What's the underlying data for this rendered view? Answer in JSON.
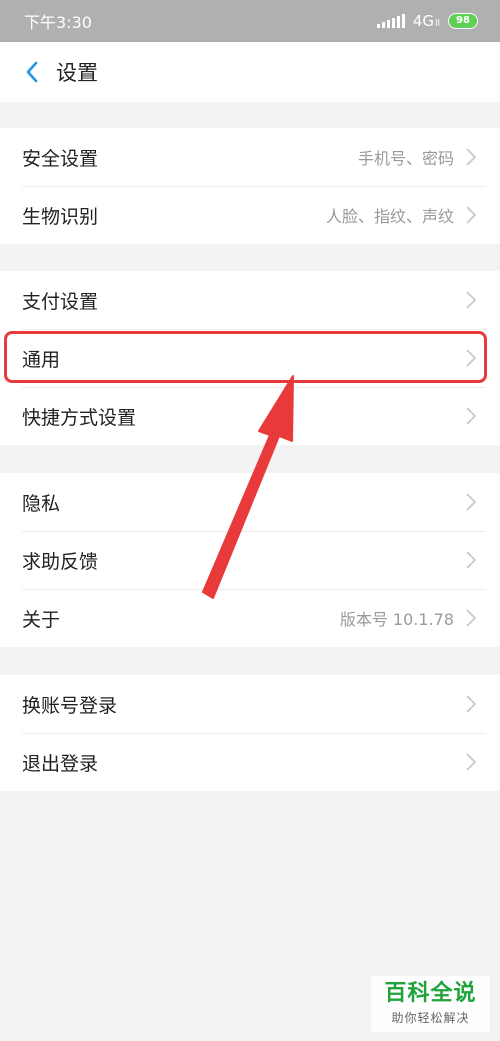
{
  "status_bar": {
    "time": "下午3:30",
    "network": "4G",
    "network_sub": "ll",
    "battery": "98"
  },
  "header": {
    "title": "设置"
  },
  "groups": [
    {
      "items": [
        {
          "label": "安全设置",
          "value": "手机号、密码"
        },
        {
          "label": "生物识别",
          "value": "人脸、指纹、声纹"
        }
      ]
    },
    {
      "items": [
        {
          "label": "支付设置",
          "value": ""
        },
        {
          "label": "通用",
          "value": ""
        },
        {
          "label": "快捷方式设置",
          "value": ""
        }
      ]
    },
    {
      "items": [
        {
          "label": "隐私",
          "value": ""
        },
        {
          "label": "求助反馈",
          "value": ""
        },
        {
          "label": "关于",
          "value": "版本号 10.1.78"
        }
      ]
    },
    {
      "items": [
        {
          "label": "换账号登录",
          "value": ""
        },
        {
          "label": "退出登录",
          "value": ""
        }
      ]
    }
  ],
  "watermark": {
    "title": "百科全说",
    "subtitle": "助你轻松解决"
  },
  "colors": {
    "accent": "#2196e8",
    "highlight": "#e83a3a",
    "watermark": "#1fa33a"
  }
}
